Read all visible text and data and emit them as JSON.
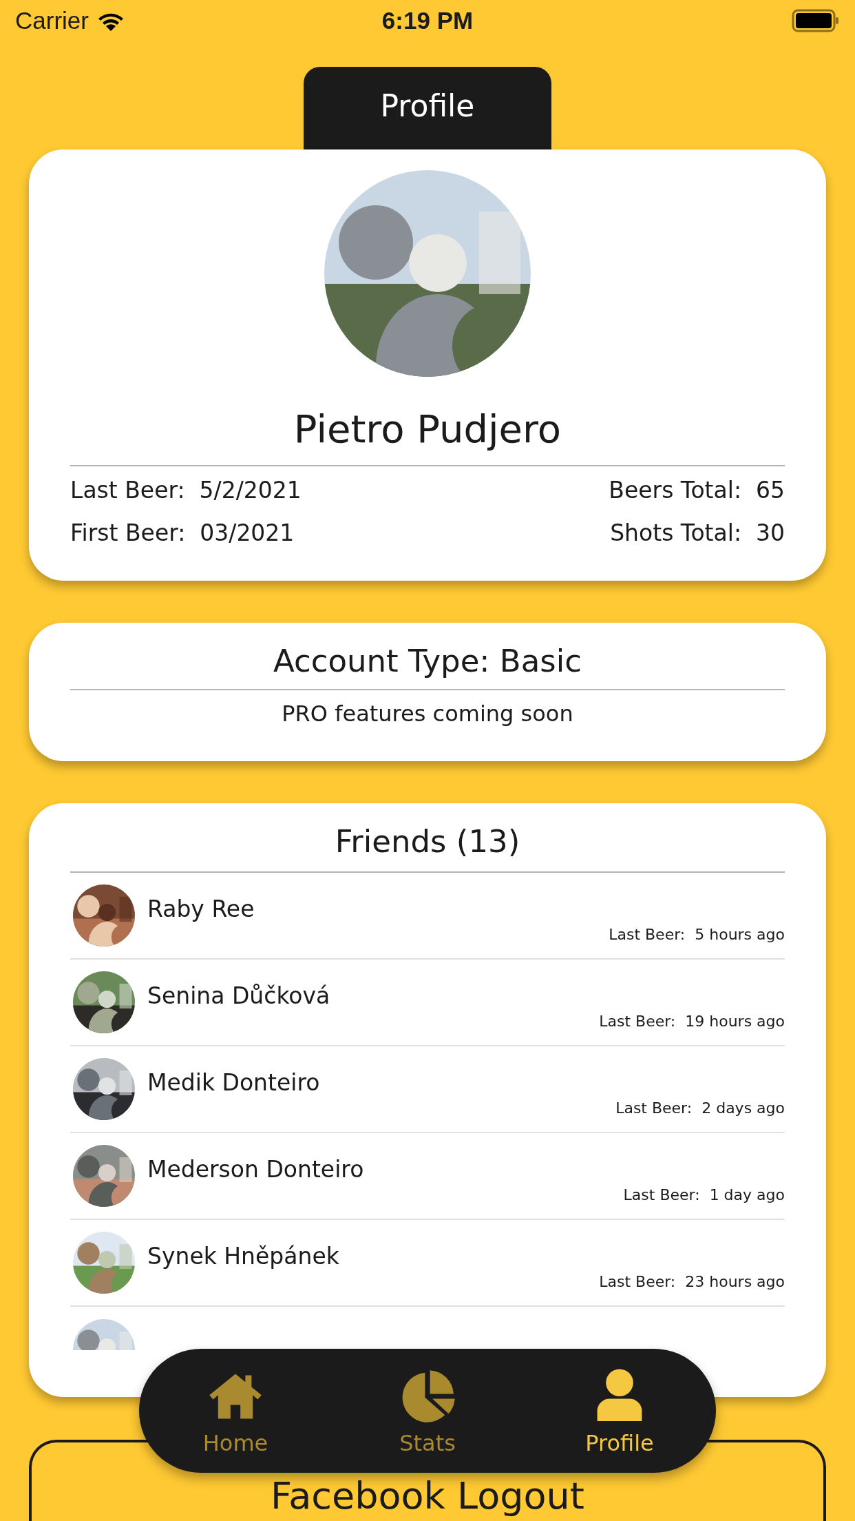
{
  "status_bar": {
    "carrier": "Carrier",
    "time": "6:19 PM"
  },
  "header_tab": {
    "label": "Profile"
  },
  "profile": {
    "name": "Pietro Pudjero",
    "stats_left": [
      "Last Beer:  5/2/2021",
      "First Beer:  03/2021"
    ],
    "stats_right": [
      "Beers Total:  65",
      "Shots Total:  30"
    ]
  },
  "account": {
    "title": "Account Type: Basic",
    "note": "PRO features coming soon"
  },
  "friends": {
    "title": "Friends (13)",
    "items": [
      {
        "name": "Raby Ree",
        "last_beer": "Last Beer:  5 hours ago"
      },
      {
        "name": "Senina Důčková",
        "last_beer": "Last Beer:  19 hours ago"
      },
      {
        "name": "Medik Donteiro",
        "last_beer": "Last Beer:  2 days ago"
      },
      {
        "name": "Mederson Donteiro",
        "last_beer": "Last Beer:  1 day ago"
      },
      {
        "name": "Synek Hněpánek",
        "last_beer": "Last Beer:  23 hours ago"
      }
    ]
  },
  "tab_bar": [
    {
      "label": "Home",
      "kind": "home",
      "selected": false
    },
    {
      "label": "Stats",
      "kind": "stats",
      "selected": false
    },
    {
      "label": "Profile",
      "kind": "profile",
      "selected": true
    }
  ],
  "logout_button": {
    "label": "Facebook Logout"
  }
}
